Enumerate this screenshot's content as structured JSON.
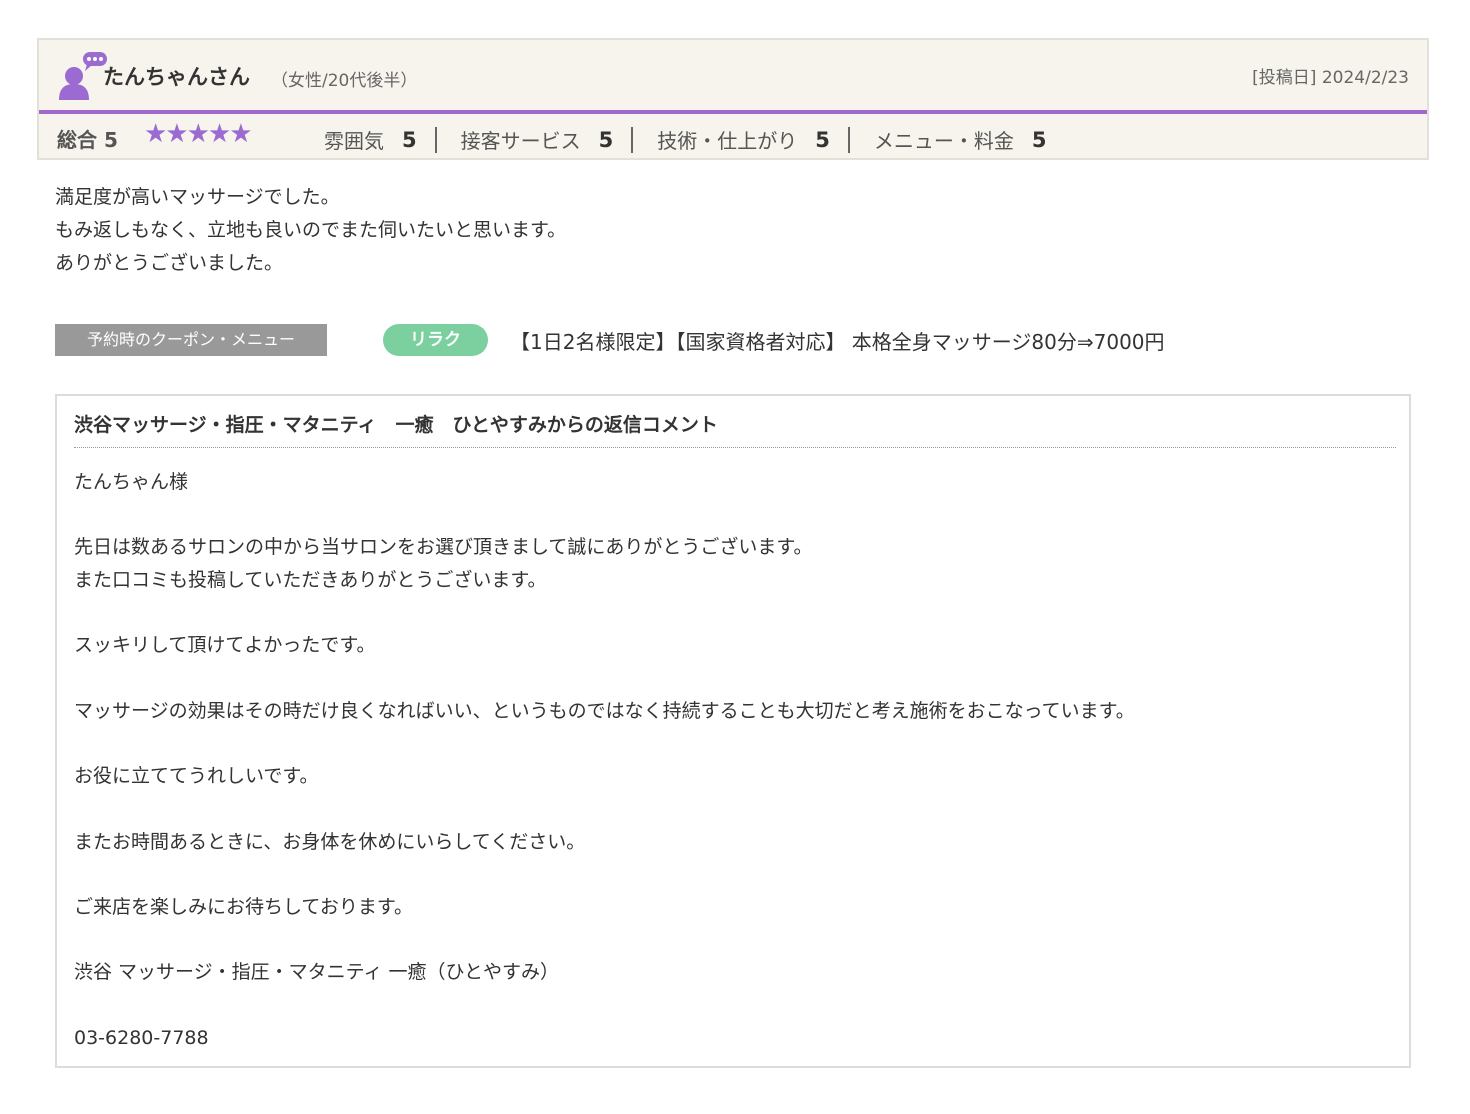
{
  "review": {
    "reviewer_name": "たんちゃんさん",
    "reviewer_attributes": "（女性/20代後半）",
    "post_date": "[投稿日] 2024/2/23",
    "overall_label": "総合 5",
    "overall_stars": "★★★★★",
    "overall_rating": 5,
    "sub_ratings": [
      {
        "label": "雰囲気",
        "score": "5"
      },
      {
        "label": "接客サービス",
        "score": "5"
      },
      {
        "label": "技術・仕上がり",
        "score": "5"
      },
      {
        "label": "メニュー・料金",
        "score": "5"
      }
    ],
    "body_lines": [
      "満足度が高いマッサージでした。",
      "もみ返しもなく、立地も良いのでまた伺いたいと思います。",
      "ありがとうございました。"
    ]
  },
  "coupon": {
    "label": "予約時のクーポン・メニュー",
    "badge": "リラク",
    "name": "【1日2名様限定】【国家資格者対応】 本格全身マッサージ80分⇒7000円"
  },
  "reply": {
    "title": "渋谷マッサージ・指圧・マタニティ　一癒　ひとやすみからの返信コメント",
    "lines": [
      "たんちゃん様",
      "",
      "先日は数あるサロンの中から当サロンをお選び頂きまして誠にありがとうございます。",
      "また口コミも投稿していただきありがとうございます。",
      "",
      "スッキリして頂けてよかったです。",
      "",
      "マッサージの効果はその時だけ良くなればいい、というものではなく持続することも大切だと考え施術をおこなっています。",
      "",
      "お役に立ててうれしいです。",
      "",
      "またお時間あるときに、お身体を休めにいらしてください。",
      "",
      "ご来店を楽しみにお待ちしております。",
      "",
      "渋谷 マッサージ・指圧・マタニティ 一癒（ひとやすみ）",
      "",
      "03-6280-7788"
    ]
  },
  "colors": {
    "accent_purple": "#a366cc",
    "star_purple": "#9b6bd1",
    "badge_green": "#7ccf9e",
    "label_gray": "#999999",
    "header_bg": "#f6f4ec"
  },
  "icons": {
    "avatar": "reviewer-avatar-icon"
  }
}
